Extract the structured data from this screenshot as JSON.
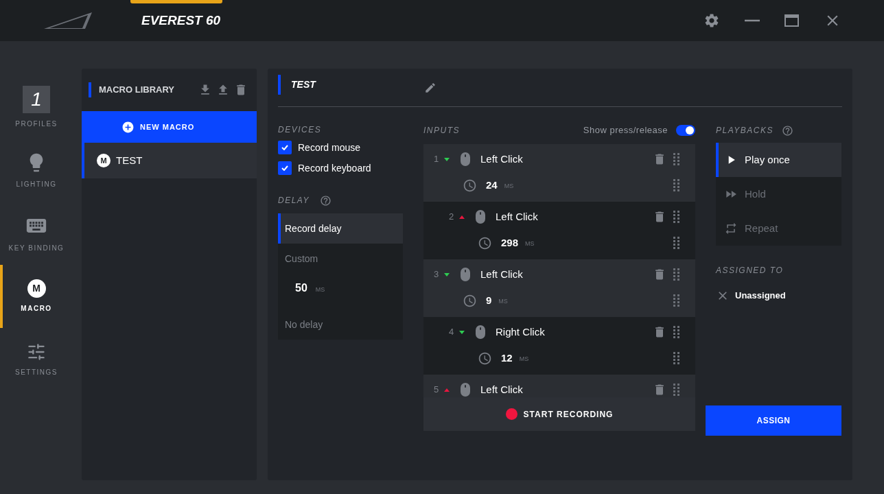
{
  "window": {
    "title": "EVEREST 60"
  },
  "nav": [
    {
      "kind": "profile",
      "badge": "1",
      "label": "PROFILES",
      "selected": false
    },
    {
      "kind": "lighting",
      "label": "LIGHTING",
      "selected": false
    },
    {
      "kind": "keys",
      "label": "KEY BINDING",
      "selected": false
    },
    {
      "kind": "macro",
      "badge": "M",
      "label": "MACRO",
      "selected": true
    },
    {
      "kind": "settings",
      "label": "SETTINGS",
      "selected": false
    }
  ],
  "library": {
    "title": "MACRO LIBRARY",
    "new_button": "NEW MACRO",
    "macros": [
      {
        "badge": "M",
        "name": "TEST",
        "selected": true
      }
    ]
  },
  "macro": {
    "name": "TEST"
  },
  "devices": {
    "title": "DEVICES",
    "options": [
      {
        "label": "Record mouse",
        "checked": true
      },
      {
        "label": "Record keyboard",
        "checked": true
      }
    ]
  },
  "delay": {
    "title": "DELAY",
    "options": [
      {
        "kind": "plain",
        "label": "Record delay",
        "selected": true
      },
      {
        "kind": "custom",
        "label": "Custom",
        "value": "50",
        "unit": "MS",
        "selected": false
      },
      {
        "kind": "plain",
        "label": "No delay",
        "selected": false
      }
    ]
  },
  "inputs": {
    "title": "INPUTS",
    "toggle_label": "Show press/release",
    "toggle_on": true,
    "rows": [
      {
        "index": "1",
        "kind": "press",
        "name": "Left Click",
        "delay": "24",
        "unit": "MS"
      },
      {
        "index": "2",
        "kind": "release",
        "name": "Left Click",
        "delay": "298",
        "unit": "MS"
      },
      {
        "index": "3",
        "kind": "press",
        "name": "Left Click",
        "delay": "9",
        "unit": "MS"
      },
      {
        "index": "4",
        "kind": "press",
        "name": "Right Click",
        "delay": "12",
        "unit": "MS"
      },
      {
        "index": "5",
        "kind": "release",
        "name": "Left Click"
      }
    ],
    "record_button": "START RECORDING"
  },
  "playbacks": {
    "title": "PLAYBACKS",
    "options": [
      {
        "kind": "once",
        "label": "Play once",
        "selected": true
      },
      {
        "kind": "hold",
        "label": "Hold",
        "selected": false
      },
      {
        "kind": "repeat",
        "label": "Repeat",
        "selected": false
      }
    ]
  },
  "assigned": {
    "title": "ASSIGNED TO",
    "value": "Unassigned"
  },
  "assign_button": "ASSIGN"
}
